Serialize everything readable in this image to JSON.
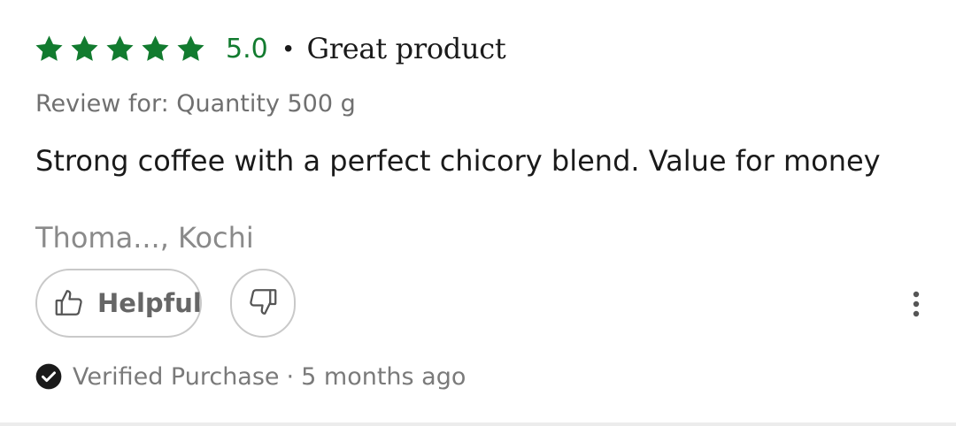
{
  "review": {
    "rating": {
      "stars_filled": 5,
      "stars_total": 5,
      "value": "5.0",
      "color": "#127b2f"
    },
    "separator": "•",
    "title": "Great product",
    "variant": "Review for: Quantity 500 g",
    "body": "Strong coffee with a perfect chicory blend. Value for money",
    "author": "Thoma..., Kochi",
    "actions": {
      "helpful_label": "Helpful",
      "helpful_icon": "thumbs-up-icon",
      "not_helpful_icon": "thumbs-down-icon",
      "more_icon": "more-vertical-icon"
    },
    "verified_label": "Verified Purchase",
    "meta_separator": "·",
    "timestamp": "5 months ago"
  }
}
